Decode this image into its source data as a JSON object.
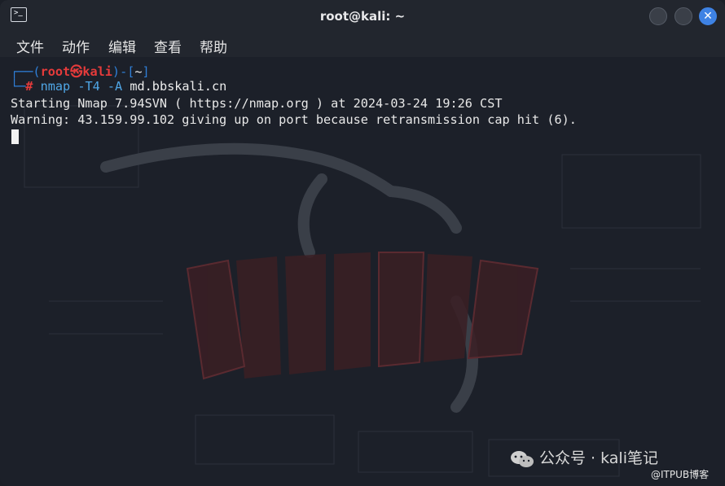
{
  "window": {
    "title": "root@kali: ~"
  },
  "menubar": {
    "items": [
      "文件",
      "动作",
      "编辑",
      "查看",
      "帮助"
    ]
  },
  "terminal": {
    "prompt_open": "┌──(",
    "prompt_user": "root",
    "prompt_at": "㉿",
    "prompt_host": "kali",
    "prompt_mid": ")-[",
    "prompt_dir": "~",
    "prompt_close": "]",
    "prompt2_prefix": "└─",
    "prompt2_hash": "#",
    "command": "nmap",
    "command_args": "-T4 -A",
    "command_target": "md.bbskali.cn",
    "output_lines": [
      "Starting Nmap 7.94SVN ( https://nmap.org ) at 2024-03-24 19:26 CST",
      "Warning: 43.159.99.102 giving up on port because retransmission cap hit (6)."
    ]
  },
  "overlay": {
    "wechat_label": "公众号 · kali笔记",
    "itpub_label": "@ITPUB博客"
  },
  "colors": {
    "background": "#1c2029",
    "titlebar": "#22262e",
    "prompt_blue": "#2f7fd8",
    "prompt_red": "#e63b3b",
    "close_button": "#3e82e4"
  }
}
